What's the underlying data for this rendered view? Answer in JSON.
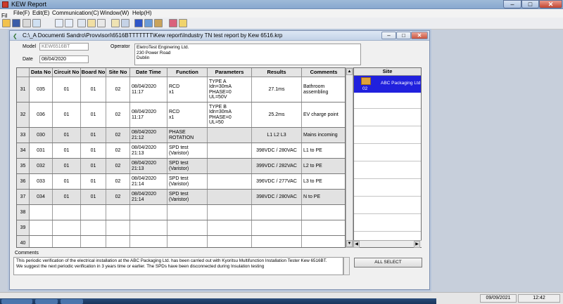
{
  "app": {
    "title": "KEW Report"
  },
  "window_controls": {
    "minimize": "–",
    "maximize": "□",
    "close": "✕"
  },
  "menu": {
    "items": [
      "File(F)",
      "Edit(E)",
      "Communication(C)",
      "Window(W)",
      "Help(H)"
    ],
    "file_short": "Fil"
  },
  "toolbar": {
    "icons": [
      "open-folder-icon",
      "save-icon",
      "print-icon",
      "print-preview-icon",
      "undo-icon",
      "redo-icon",
      "copy-icon",
      "paste-icon",
      "cut-icon",
      "page-setup-icon",
      "settings-icon",
      "download-icon",
      "send-icon",
      "tools-icon",
      "clear-icon",
      "help-icon"
    ]
  },
  "doc": {
    "path": "C:\\_A Documenti Sandro\\Provvisori\\6516BTTTTTTT\\Kew report\\Industry TN test report by Kew 6516.krp",
    "model_label": "Model",
    "model_value": "KEW6516BT",
    "date_label": "Date",
    "date_value": "08/04/2020",
    "operator_label": "Operator",
    "operator_lines": [
      "EletroTest Enginering Ltd.",
      "230 Power Road",
      "Dublin"
    ]
  },
  "table": {
    "headers": [
      "Data No",
      "Circuit No",
      "Board No",
      "Site No",
      "Date Time",
      "Function",
      "Parameters",
      "Results",
      "Comments"
    ],
    "rows": [
      {
        "n": "31",
        "data": "035",
        "circuit": "01",
        "board": "01",
        "site": "02",
        "dt": [
          "08/04/2020",
          "11:17"
        ],
        "fn": [
          "RCD",
          "x1"
        ],
        "params": [
          "TYPE A",
          "Idn=30mA",
          "PHASE=0",
          "UL=50V"
        ],
        "result": "27.1ms",
        "comment": [
          "Bathroom",
          "assembling"
        ]
      },
      {
        "n": "32",
        "data": "036",
        "circuit": "01",
        "board": "01",
        "site": "02",
        "dt": [
          "08/04/2020",
          "11:17"
        ],
        "fn": [
          "RCD",
          "x1"
        ],
        "params": [
          "TYPE B",
          "Idn=30mA",
          "PHASE=0",
          "UL=50"
        ],
        "result": "25.2ms",
        "comment": [
          "EV charge point"
        ]
      },
      {
        "n": "33",
        "data": "030",
        "circuit": "01",
        "board": "01",
        "site": "02",
        "dt": [
          "08/04/2020",
          "21:12"
        ],
        "fn": [
          "PHASE",
          "ROTATION"
        ],
        "params": [],
        "result": "L1  L2  L3",
        "comment": [
          "Mains incoming"
        ]
      },
      {
        "n": "34",
        "data": "031",
        "circuit": "01",
        "board": "01",
        "site": "02",
        "dt": [
          "08/04/2020",
          "21:13"
        ],
        "fn": [
          "SPD test",
          "(Varistor)"
        ],
        "params": [],
        "result": "398VDC / 280VAC",
        "comment": [
          "L1 to PE"
        ]
      },
      {
        "n": "35",
        "data": "032",
        "circuit": "01",
        "board": "01",
        "site": "02",
        "dt": [
          "08/04/2020",
          "21:13"
        ],
        "fn": [
          "SPD test",
          "(Varistor)"
        ],
        "params": [],
        "result": "399VDC / 282VAC",
        "comment": [
          "L2 to PE"
        ]
      },
      {
        "n": "36",
        "data": "033",
        "circuit": "01",
        "board": "01",
        "site": "02",
        "dt": [
          "08/04/2020",
          "21:14"
        ],
        "fn": [
          "SPD test",
          "(Varistor)"
        ],
        "params": [],
        "result": "396VDC / 277VAC",
        "comment": [
          "L3 to PE"
        ]
      },
      {
        "n": "37",
        "data": "034",
        "circuit": "01",
        "board": "01",
        "site": "02",
        "dt": [
          "08/04/2020",
          "21:14"
        ],
        "fn": [
          "SPD test",
          "(Varistor)"
        ],
        "params": [],
        "result": "398VDC / 280VAC",
        "comment": [
          "N to PE"
        ]
      },
      {
        "n": "38"
      },
      {
        "n": "39"
      },
      {
        "n": "40"
      }
    ]
  },
  "site_panel": {
    "header": "Site",
    "selected_number": "02",
    "selected_name": "ABC Packaging Ltd"
  },
  "comments": {
    "label": "Comments",
    "text": "This periodic verification of the electrical installation at the ABC Packaging Ltd. has been carried out with Kyoritsu Multifunction Installation Tester Kew 6516BT.\nWe suggest the next periodic verification in 3 years time or earlier. The SPDs have been disconnected during Insulation testing"
  },
  "all_select_label": "ALL SELECT",
  "status": {
    "date": "09/09/2021",
    "time": "12:42"
  }
}
